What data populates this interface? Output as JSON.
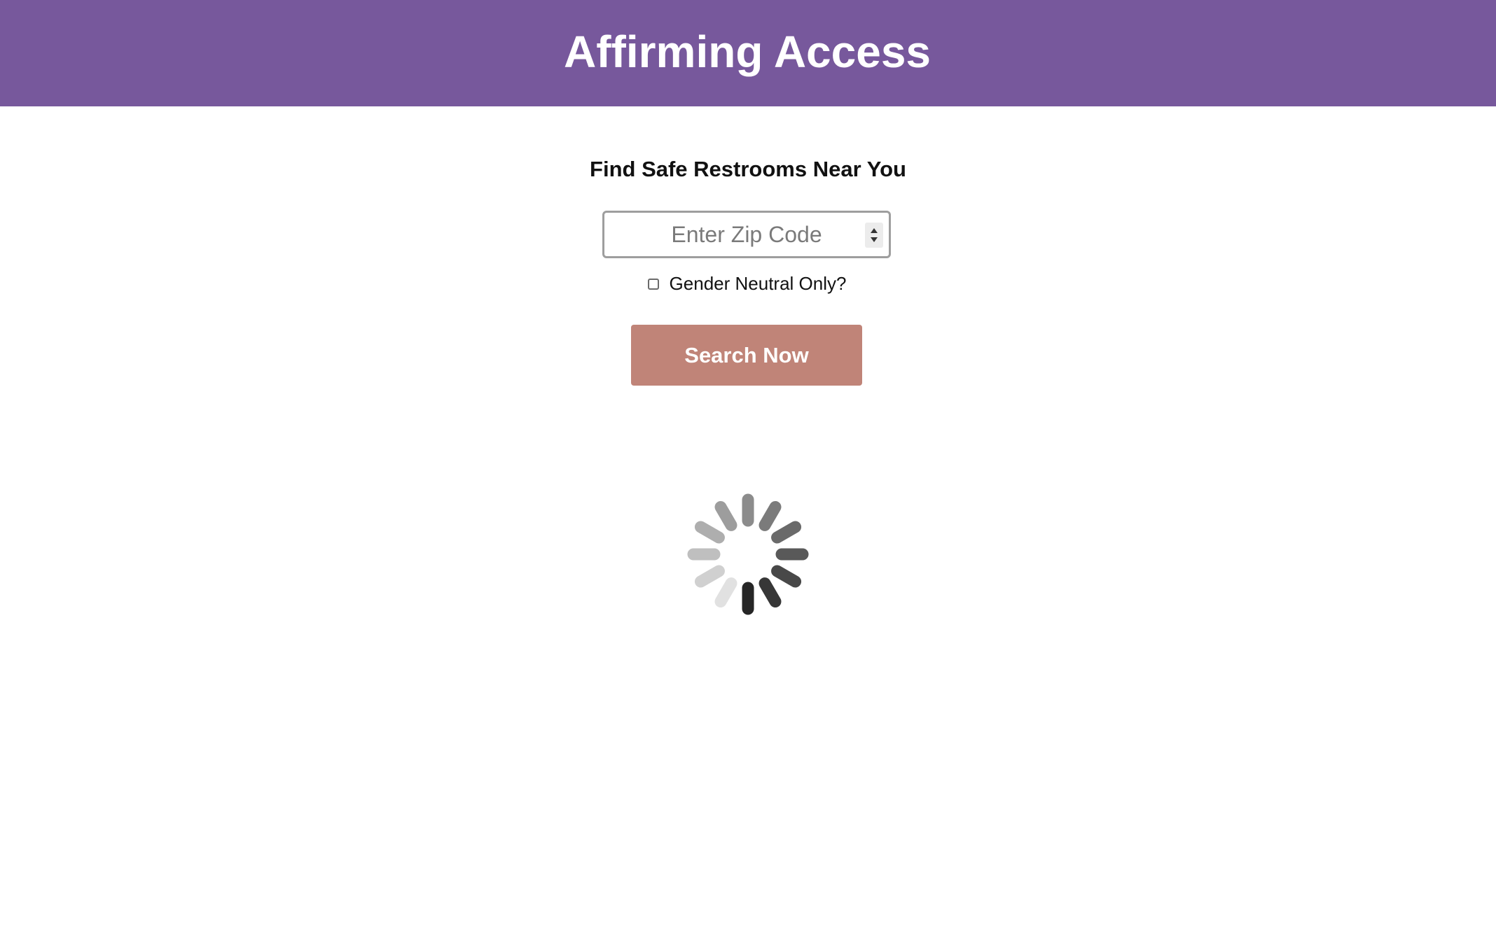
{
  "header": {
    "title": "Affirming Access",
    "background": "#77589c"
  },
  "search": {
    "heading": "Find Safe Restrooms Near You",
    "zip_placeholder": "Enter Zip Code",
    "zip_value": "",
    "gender_neutral_label": "Gender Neutral Only?",
    "gender_neutral_checked": false,
    "button_label": "Search Now",
    "button_color": "#c08478"
  },
  "loading": {
    "icon": "loading-spinner-icon",
    "spoke_count": 12
  }
}
